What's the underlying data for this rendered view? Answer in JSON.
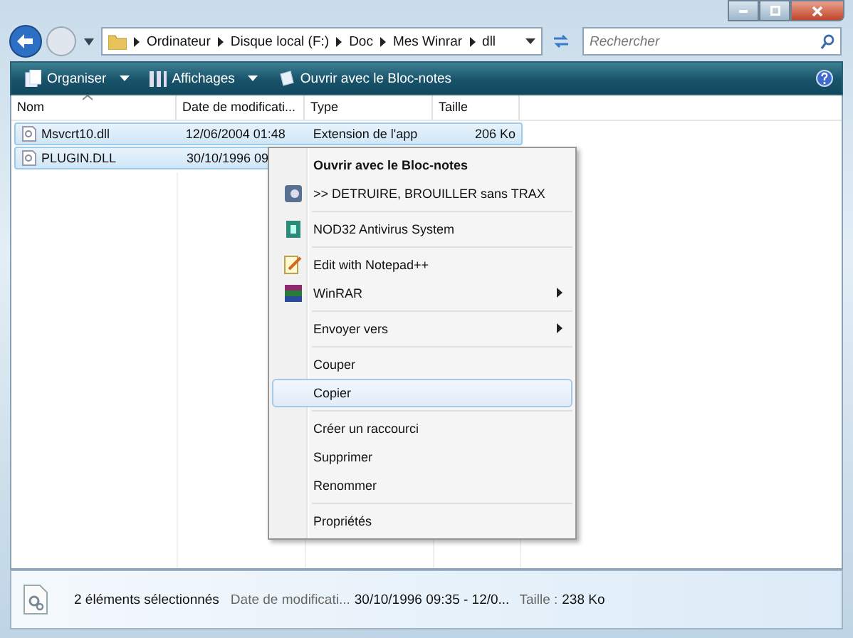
{
  "address": {
    "crumbs": [
      "Ordinateur",
      "Disque local (F:)",
      "Doc",
      "Mes Winrar",
      "dll"
    ]
  },
  "search": {
    "placeholder": "Rechercher"
  },
  "toolbar": {
    "buttons": [
      {
        "label": "Organiser",
        "dropdown": true
      },
      {
        "label": "Affichages",
        "dropdown": true
      },
      {
        "label": "Ouvrir avec le Bloc-notes",
        "dropdown": false
      }
    ]
  },
  "table": {
    "columns": [
      "Nom",
      "Date de modificati...",
      "Type",
      "Taille"
    ],
    "rows": [
      {
        "selected": true,
        "cells": [
          "Msvcrt10.dll",
          "12/06/2004 01:48",
          "Extension de l'app",
          "206 Ko"
        ]
      },
      {
        "selected": true,
        "cells": [
          "PLUGIN.DLL",
          "30/10/1996 09"
        ]
      }
    ]
  },
  "context_menu": {
    "items": [
      {
        "kind": "item",
        "label": "Ouvrir avec le Bloc-notes",
        "bold": true,
        "submenu": false,
        "selected": false
      },
      {
        "kind": "item",
        "label": ">> DETRUIRE, BROUILLER sans TRAX",
        "bold": false,
        "submenu": false,
        "selected": false
      },
      {
        "kind": "separator"
      },
      {
        "kind": "item",
        "label": "NOD32 Antivirus System",
        "bold": false,
        "submenu": false,
        "selected": false
      },
      {
        "kind": "separator"
      },
      {
        "kind": "item",
        "label": "Edit with Notepad++",
        "bold": false,
        "submenu": false,
        "selected": false
      },
      {
        "kind": "item",
        "label": "WinRAR",
        "bold": false,
        "submenu": true,
        "selected": false
      },
      {
        "kind": "separator"
      },
      {
        "kind": "item",
        "label": "Envoyer vers",
        "bold": false,
        "submenu": true,
        "selected": false
      },
      {
        "kind": "separator"
      },
      {
        "kind": "item",
        "label": "Couper",
        "bold": false,
        "submenu": false,
        "selected": false
      },
      {
        "kind": "item",
        "label": "Copier",
        "bold": false,
        "submenu": false,
        "selected": true
      },
      {
        "kind": "separator"
      },
      {
        "kind": "item",
        "label": "Créer un raccourci",
        "bold": false,
        "submenu": false,
        "selected": false
      },
      {
        "kind": "item",
        "label": "Supprimer",
        "bold": false,
        "submenu": false,
        "selected": false
      },
      {
        "kind": "item",
        "label": "Renommer",
        "bold": false,
        "submenu": false,
        "selected": false
      },
      {
        "kind": "separator"
      },
      {
        "kind": "item",
        "label": "Propriétés",
        "bold": false,
        "submenu": false,
        "selected": false
      }
    ]
  },
  "status_bar": {
    "summary": "2 éléments sélectionnés",
    "fields": [
      {
        "label": "Date de modificati...",
        "value": "30/10/1996 09:35 - 12/0..."
      },
      {
        "label": "Taille :",
        "value": "238 Ko"
      }
    ]
  }
}
